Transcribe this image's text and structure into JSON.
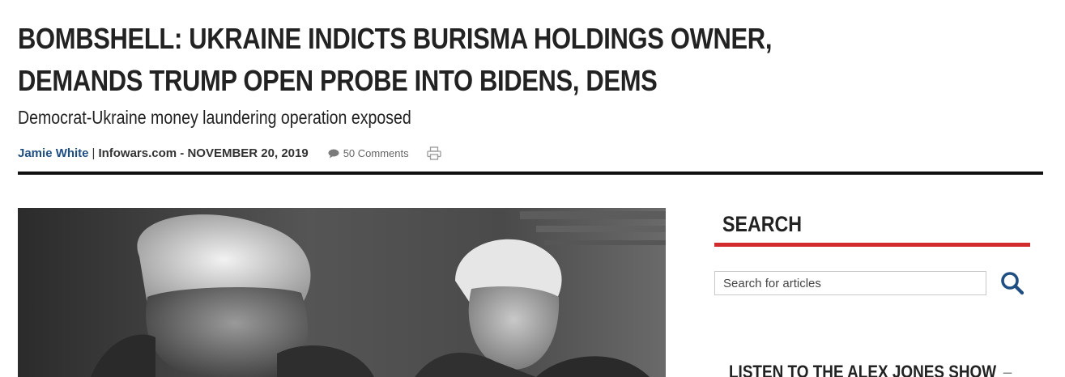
{
  "article": {
    "headline": "BOMBSHELL: UKRAINE INDICTS BURISMA HOLDINGS OWNER, DEMANDS TRUMP OPEN PROBE INTO BIDENS, DEMS",
    "subtitle": "Democrat-Ukraine money laundering operation exposed",
    "author": "Jamie White",
    "separator": "|",
    "source_date": "Infowars.com - NOVEMBER 20, 2019",
    "comments": "50 Comments",
    "comments_icon": "comment-icon",
    "print_icon": "print-icon",
    "hero_image": "photo-trump-and-biden-black-and-white"
  },
  "sidebar": {
    "search": {
      "title": "SEARCH",
      "placeholder": "Search for articles",
      "value": "",
      "button_icon": "search-icon"
    },
    "listen": {
      "title": "LISTEN TO THE ALEX JONES SHOW",
      "trailing": "–"
    }
  },
  "colors": {
    "author_link": "#1f4f82",
    "widget_accent": "#d12b2b",
    "search_icon": "#1f4f82",
    "rule": "#111111"
  }
}
